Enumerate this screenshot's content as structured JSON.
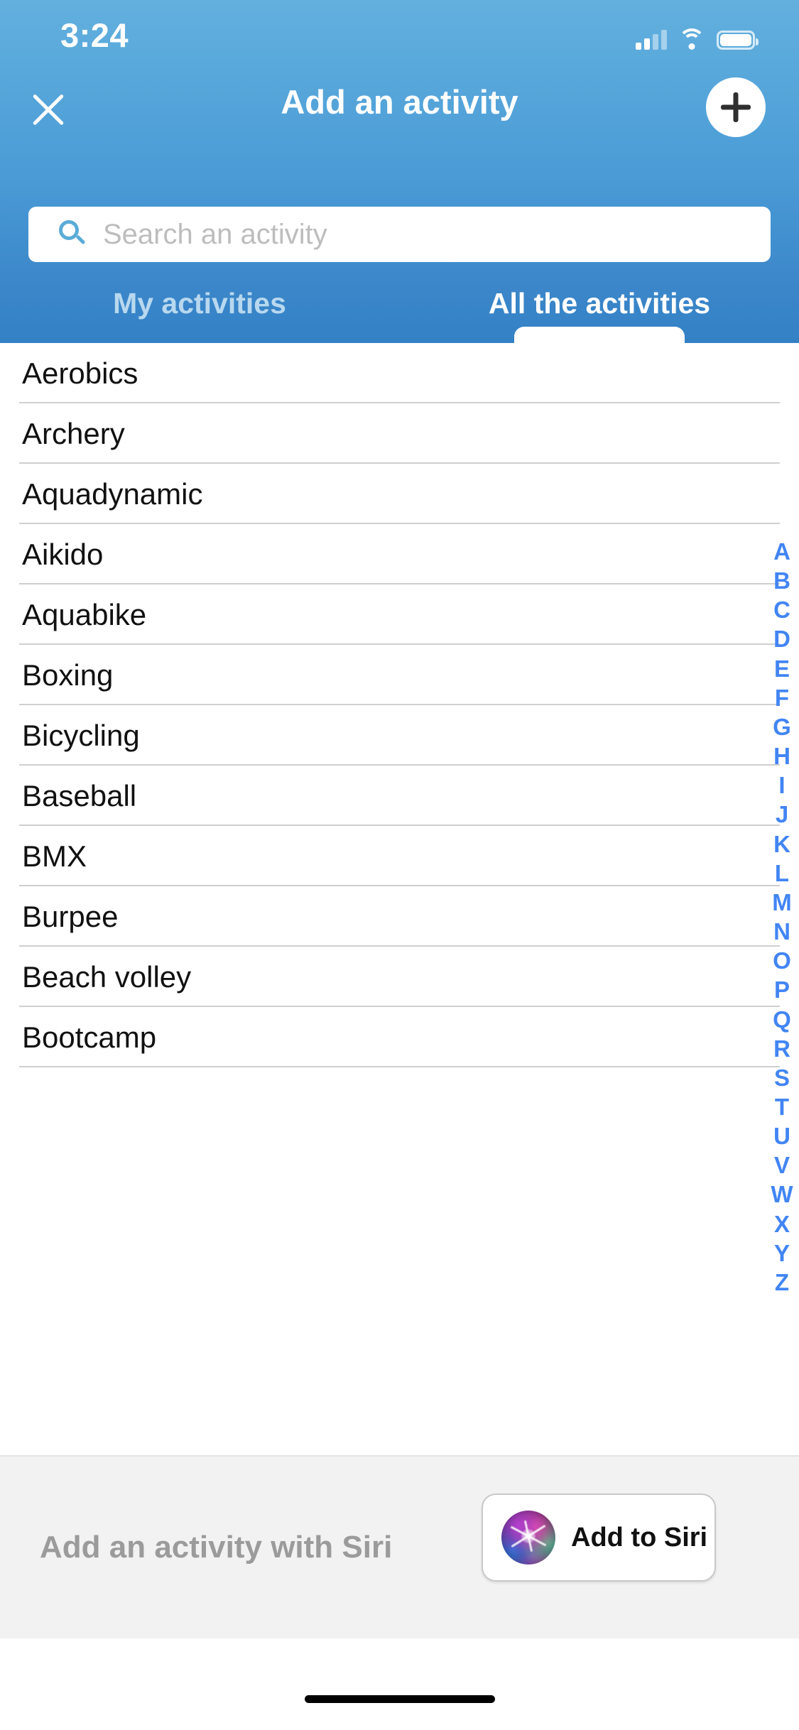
{
  "status_bar": {
    "time": "3:24",
    "signal_icon": "cellular-signal-icon",
    "wifi_icon": "wifi-icon",
    "battery_icon": "battery-icon"
  },
  "header": {
    "title": "Add an activity",
    "close_icon": "close-icon",
    "add_icon": "plus-icon",
    "background_color": "#4a9bd6"
  },
  "search": {
    "placeholder": "Search an activity",
    "value": "",
    "icon": "search-icon",
    "icon_color": "#5babd8"
  },
  "tabs": [
    {
      "label": "My activities",
      "active": false
    },
    {
      "label": "All the activities",
      "active": true
    }
  ],
  "list": {
    "items": [
      {
        "label": "Aerobics"
      },
      {
        "label": "Archery"
      },
      {
        "label": "Aquadynamic"
      },
      {
        "label": "Aikido"
      },
      {
        "label": "Aquabike"
      },
      {
        "label": "Boxing"
      },
      {
        "label": "Bicycling"
      },
      {
        "label": "Baseball"
      },
      {
        "label": "BMX"
      },
      {
        "label": "Burpee"
      },
      {
        "label": "Beach volley"
      },
      {
        "label": "Bootcamp"
      }
    ]
  },
  "alphabet_index": {
    "color": "#4285f4",
    "letters": [
      "A",
      "B",
      "C",
      "D",
      "E",
      "F",
      "G",
      "H",
      "I",
      "J",
      "K",
      "L",
      "M",
      "N",
      "O",
      "P",
      "Q",
      "R",
      "S",
      "T",
      "U",
      "V",
      "W",
      "X",
      "Y",
      "Z"
    ]
  },
  "siri_footer": {
    "prompt": "Add an activity with Siri",
    "button_label": "Add to Siri",
    "orb_icon": "siri-orb-icon",
    "background_color": "#f2f2f2"
  },
  "home_indicator": "home-indicator"
}
